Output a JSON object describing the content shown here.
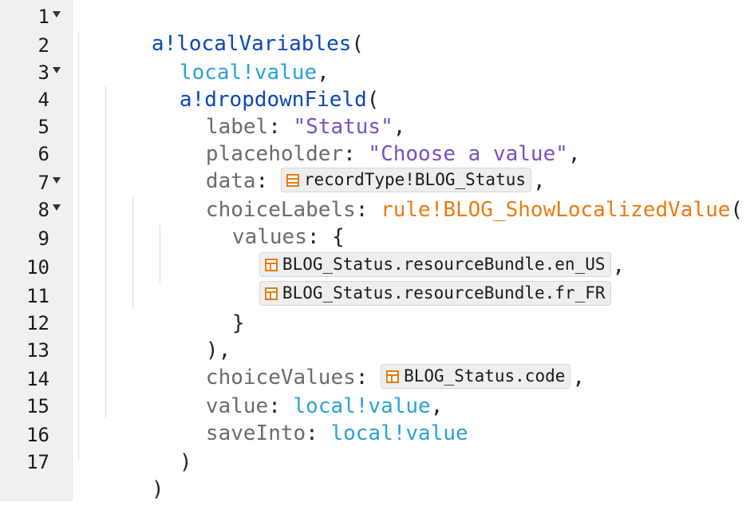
{
  "editor": {
    "lines": [
      {
        "n": "1",
        "p": [
          "a!localVariables",
          "("
        ]
      },
      {
        "n": "2",
        "p": [
          "local!value",
          ","
        ]
      },
      {
        "n": "3",
        "p": [
          "a!dropdownField",
          "("
        ]
      },
      {
        "n": "4",
        "p": [
          "label",
          ": ",
          "\"Status\"",
          ","
        ]
      },
      {
        "n": "5",
        "p": [
          "placeholder",
          ": ",
          "\"Choose a value\"",
          ","
        ]
      },
      {
        "n": "6",
        "p": [
          "data",
          ": ",
          "recordType!BLOG_Status",
          ","
        ]
      },
      {
        "n": "7",
        "p": [
          "choiceLabels",
          ": ",
          "rule!BLOG_ShowLocalizedValue",
          "("
        ]
      },
      {
        "n": "8",
        "p": [
          "values",
          ": {"
        ]
      },
      {
        "n": "9",
        "p": [
          "BLOG_Status.resourceBundle.en_US",
          ","
        ]
      },
      {
        "n": "10",
        "p": [
          "BLOG_Status.resourceBundle.fr_FR"
        ]
      },
      {
        "n": "11",
        "p": [
          "}"
        ]
      },
      {
        "n": "12",
        "p": [
          "),"
        ]
      },
      {
        "n": "13",
        "p": [
          "choiceValues",
          ": ",
          "BLOG_Status.code",
          ","
        ]
      },
      {
        "n": "14",
        "p": [
          "value",
          ": ",
          "local!value",
          ","
        ]
      },
      {
        "n": "15",
        "p": [
          "saveInto",
          ": ",
          "local!value"
        ]
      },
      {
        "n": "16",
        "p": [
          ")"
        ]
      },
      {
        "n": "17",
        "p": [
          ")"
        ]
      }
    ]
  },
  "icons": {
    "fold": "fold-arrow-icon",
    "record_type": "record-type-icon",
    "table_field": "record-field-icon"
  },
  "colors": {
    "function": "#0a47b8",
    "property": "#6b6b6b",
    "string": "#7b4fc1",
    "variable": "#2aa2d8",
    "rule": "#ec7a12",
    "chip_icon": "#e77b16"
  }
}
